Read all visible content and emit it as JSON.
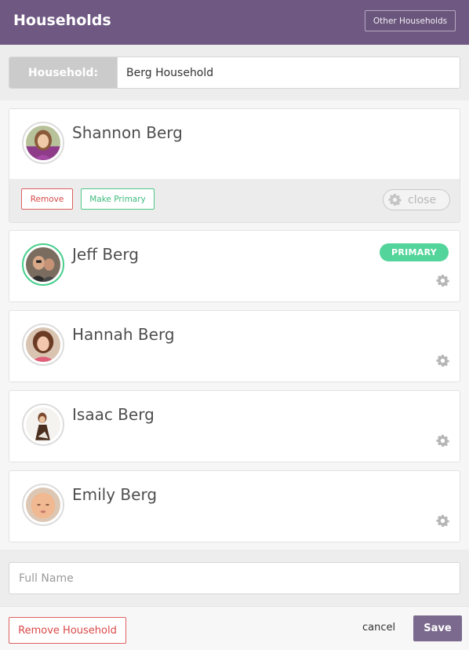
{
  "header": {
    "title": "Households",
    "other_households_label": "Other Households"
  },
  "household": {
    "label": "Household:",
    "value": "Berg Household"
  },
  "members": [
    {
      "name": "Shannon Berg",
      "expanded": true
    },
    {
      "name": "Jeff Berg",
      "primary": true,
      "badge": "PRIMARY"
    },
    {
      "name": "Hannah Berg"
    },
    {
      "name": "Isaac Berg"
    },
    {
      "name": "Emily Berg"
    }
  ],
  "member_actions": {
    "remove_label": "Remove",
    "make_primary_label": "Make Primary",
    "close_label": "close"
  },
  "new_member": {
    "placeholder": "Full Name"
  },
  "footer": {
    "remove_household_label": "Remove Household",
    "cancel_label": "cancel",
    "save_label": "Save"
  },
  "colors": {
    "header_bg": "#6f5982",
    "primary_green": "#53d49a",
    "danger_red": "#d94848",
    "save_bg": "#7b6a8d"
  },
  "icons": {
    "settings": "gear-icon"
  }
}
